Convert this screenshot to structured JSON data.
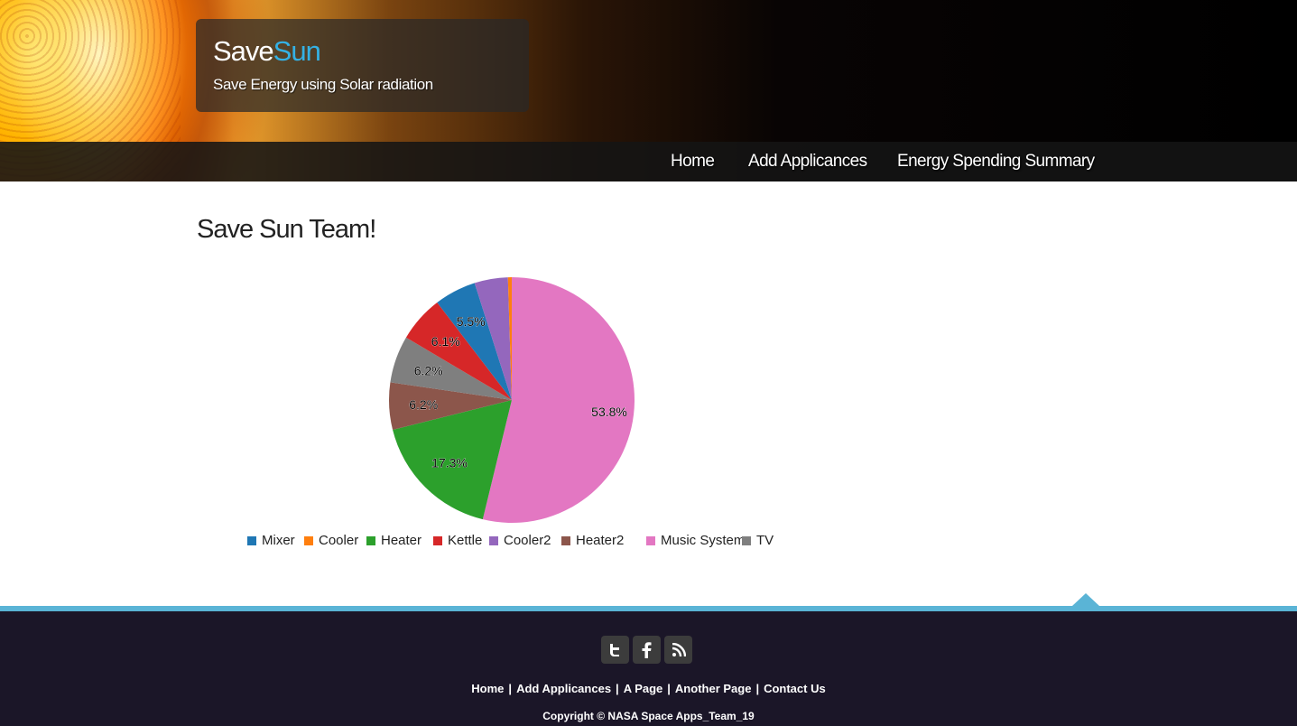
{
  "header": {
    "title_part1": "Save",
    "title_part2": "Sun",
    "tagline": "Save Energy using Solar radiation",
    "accent_color": "#34b1e4"
  },
  "nav": {
    "items": [
      {
        "label": "Home"
      },
      {
        "label": "Add Applicances"
      },
      {
        "label": "Energy Spending Summary"
      }
    ]
  },
  "main": {
    "heading": "Save Sun Team!"
  },
  "chart_data": {
    "type": "pie",
    "title": "",
    "slices": [
      {
        "label": "Music System",
        "value": 53.8,
        "color": "#e377c2",
        "text": "53.8%"
      },
      {
        "label": "Heater",
        "value": 17.3,
        "color": "#2ca02c",
        "text": "17.3%"
      },
      {
        "label": "Heater2",
        "value": 6.2,
        "color": "#8c564b",
        "text": "6.2%"
      },
      {
        "label": "TV",
        "value": 6.2,
        "color": "#7f7f7f",
        "text": "6.2%"
      },
      {
        "label": "Kettle",
        "value": 6.1,
        "color": "#d62728",
        "text": "6.1%"
      },
      {
        "label": "Mixer",
        "value": 5.5,
        "color": "#1f77b4",
        "text": "5.5%"
      },
      {
        "label": "Cooler2",
        "value": 4.4,
        "color": "#9467bd",
        "text": ""
      },
      {
        "label": "Cooler",
        "value": 0.5,
        "color": "#ff7f0e",
        "text": ""
      }
    ],
    "legend_order": [
      "Mixer",
      "Cooler",
      "Heater",
      "Kettle",
      "Cooler2",
      "Heater2",
      "Music System",
      "TV"
    ],
    "legend_placement": "bottom"
  },
  "footer": {
    "social_icons": [
      "twitter-icon",
      "facebook-icon",
      "rss-icon"
    ],
    "links": [
      "Home",
      "Add Applicances",
      "A Page",
      "Another Page",
      "Contact Us"
    ],
    "copyright": "Copyright © NASA Space Apps_Team_19",
    "stripe_color": "#5ab4d6",
    "background_color": "#1b1628"
  }
}
